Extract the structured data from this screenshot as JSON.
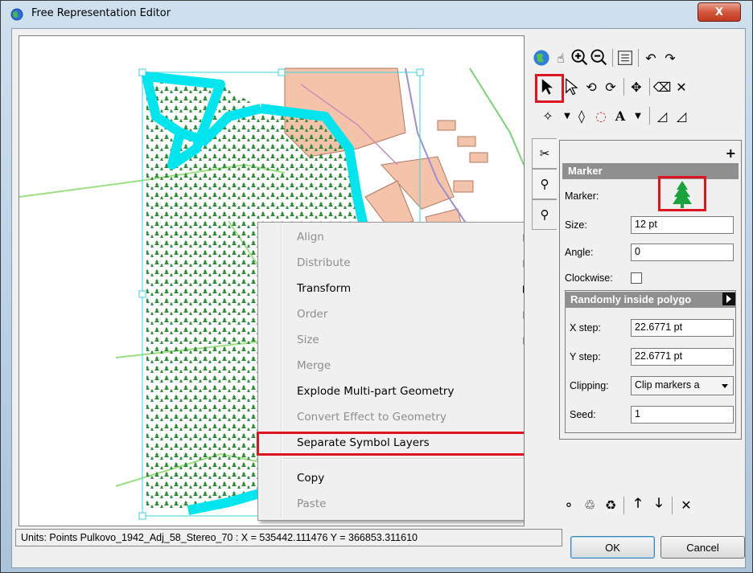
{
  "window": {
    "title": "Free Representation Editor",
    "close_label": "X"
  },
  "context_menu": {
    "items": [
      {
        "label": "Align",
        "enabled": false,
        "submenu": true
      },
      {
        "label": "Distribute",
        "enabled": false,
        "submenu": true
      },
      {
        "label": "Transform",
        "enabled": true,
        "submenu": true
      },
      {
        "label": "Order",
        "enabled": false,
        "submenu": true
      },
      {
        "label": "Size",
        "enabled": false,
        "submenu": true
      },
      {
        "label": "Merge",
        "enabled": false,
        "submenu": false
      },
      {
        "label": "Explode Multi-part Geometry",
        "enabled": true,
        "submenu": false
      },
      {
        "label": "Convert Effect to Geometry",
        "enabled": false,
        "submenu": false
      },
      {
        "label": "Separate Symbol Layers",
        "enabled": true,
        "submenu": false,
        "highlighted": true
      },
      {
        "label": "Copy",
        "enabled": true,
        "submenu": false
      },
      {
        "label": "Paste",
        "enabled": false,
        "submenu": false
      }
    ]
  },
  "toolbar": {
    "icons": [
      "globe-icon",
      "pan-hand-icon",
      "zoom-in-icon",
      "zoom-out-icon",
      "full-extent-icon",
      "undo-icon",
      "redo-icon",
      "select-tool-icon",
      "direct-select-icon",
      "lasso-select-icon",
      "lasso-direct-select-icon",
      "move-icon",
      "eraser-icon",
      "delete-icon",
      "add-vertex-icon",
      "shape-tool-icon",
      "reshape-tool-icon",
      "text-tool-icon",
      "measure-icon",
      "measure-2-icon"
    ]
  },
  "marker_panel": {
    "header": "Marker",
    "plus_label": "+",
    "marker_label": "Marker:",
    "size_label": "Size:",
    "size_value": "12 pt",
    "angle_label": "Angle:",
    "angle_value": "0",
    "clockwise_label": "Clockwise:",
    "clockwise_checked": false,
    "placement_header": "Randomly inside polygo",
    "xstep_label": "X step:",
    "xstep_value": "22.6771 pt",
    "ystep_label": "Y step:",
    "ystep_value": "22.6771 pt",
    "clipping_label": "Clipping:",
    "clipping_value": "Clip markers a",
    "seed_label": "Seed:",
    "seed_value": "1"
  },
  "status_bar": {
    "text": "Units: Points   Pulkovo_1942_Adj_58_Stereo_70 :  X = 535442.111476   Y = 366853.311610"
  },
  "buttons": {
    "ok": "OK",
    "cancel": "Cancel"
  },
  "colors": {
    "highlight": "#e0141f",
    "selection": "#00e5ee",
    "tree": "#2e8b3a",
    "marker_tree": "#1aa33c"
  }
}
